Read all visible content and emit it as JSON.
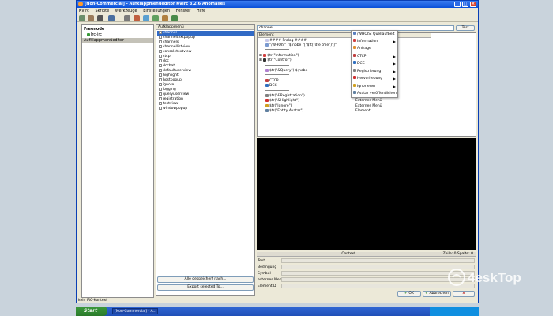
{
  "window": {
    "title": "[Non-Commercial] - Aufklappmenüeditor KVIrc 3.2.6 Anomalies"
  },
  "menubar": [
    "KVIrc",
    "Skripte",
    "Werkzeuge",
    "Einstellungen",
    "Fenster",
    "Hilfe"
  ],
  "tree": {
    "items": [
      "Freenode",
      "Irc-irc",
      "Aufklappmenüeditor"
    ]
  },
  "popup_list": {
    "header": "Aufklappmenü",
    "items": [
      "channel",
      "channeltextpopup",
      "channels",
      "channellistview",
      "consoletextview",
      "ctcp",
      "dcc",
      "dcchat",
      "defaultuserview",
      "highlight",
      "hostpopup",
      "ignore",
      "logging",
      "queryuserview",
      "registration",
      "textview",
      "windowpopup"
    ],
    "selected": "channel",
    "btn_add": "Alle gespeichert nach...",
    "btn_export": "Export selected To..."
  },
  "editor": {
    "name_field": "channel",
    "test_button": "Test",
    "col_element": "Element",
    "col_type": "Typ",
    "rows": [
      {
        "element": "#### Prolog ####",
        "type": "Prolog"
      },
      {
        "element": "\"/WHOIS\" \"$;nobe \"[\"$ft(\"dfe tme\")\"]\"",
        "type": "Element"
      },
      {
        "element": "",
        "type": "Trenner"
      },
      {
        "element": "$tr(\"Information\")",
        "type": "Untermenü"
      },
      {
        "element": "$tr(\"Control\")",
        "type": "Untermenü"
      },
      {
        "element": "",
        "type": "Trenner"
      },
      {
        "element": "$tr(\"&Query\") $;nobe",
        "type": "Element"
      },
      {
        "element": "",
        "type": "Trenner"
      },
      {
        "element": "CTCP",
        "type": "Externes Menü"
      },
      {
        "element": "DCC",
        "type": "Externes Menü"
      },
      {
        "element": "",
        "type": "Trenner"
      },
      {
        "element": "$tr(\"&Registration\")",
        "type": "Externes Menü"
      },
      {
        "element": "$tr(\"&Highlight\")",
        "type": "Externes Menü"
      },
      {
        "element": "$tr(\"Ignore\")",
        "type": "Externes Menü"
      },
      {
        "element": "$tr(\"Entity Avatar\")",
        "type": "Element"
      }
    ]
  },
  "context_menu": {
    "items": [
      {
        "label": "/WHOIS: Quellaufbeit",
        "icon_color": "#5a7fbf"
      },
      {
        "label": "Information",
        "icon_color": "#d04040"
      },
      {
        "label": "Anfrage",
        "icon_color": "#e09030"
      },
      {
        "label": "CTCP",
        "icon_color": "#c04040"
      },
      {
        "label": "DCC",
        "icon_color": "#3070c0"
      },
      {
        "label": "Registrierung",
        "icon_color": "#808080"
      },
      {
        "label": "Hervorhebung",
        "icon_color": "#d03030"
      },
      {
        "label": "Ignorieren",
        "icon_color": "#d0a020"
      },
      {
        "label": "Avatar veröffentlichen",
        "icon_color": "#6080a0"
      }
    ]
  },
  "details": {
    "header_left": "Context",
    "header_right": "Zeile: 0 Spalte: 0",
    "labels": [
      "Text",
      "Bedingung",
      "Symbol",
      "externes Menü",
      "ElementID"
    ]
  },
  "dialog": {
    "ok": "OK",
    "cancel": "Abbrechen",
    "extra": ""
  },
  "status_bar": "kein IRC-Kontext",
  "taskbar": {
    "start": "Start",
    "app": "[Non-Commercial] - A..."
  },
  "colors": {
    "accent": "#0a50d8",
    "preview_bg": "#000000"
  }
}
